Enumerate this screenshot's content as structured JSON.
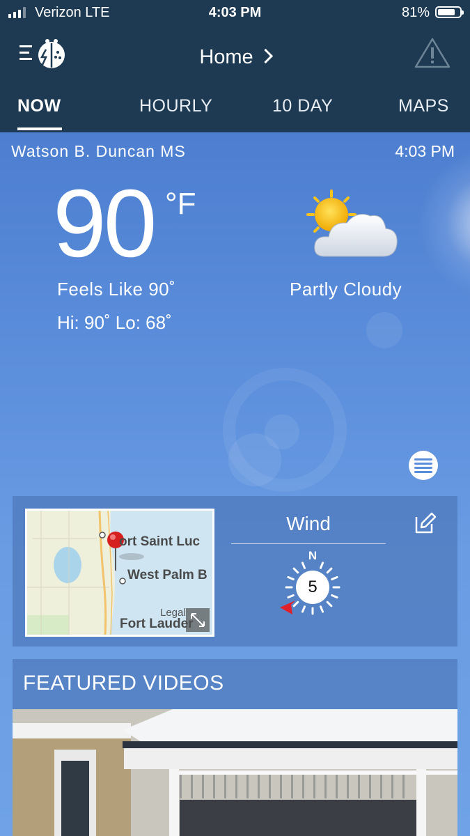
{
  "status_bar": {
    "carrier": "Verizon  LTE",
    "time": "4:03 PM",
    "battery": "81%",
    "battery_level": 0.81
  },
  "header": {
    "title": "Home",
    "menu_icon": "menu-logo-icon",
    "alert_icon": "warning-triangle-icon"
  },
  "tabs": [
    {
      "label": "NOW",
      "active": true
    },
    {
      "label": "HOURLY",
      "active": false
    },
    {
      "label": "10  DAY",
      "active": false
    },
    {
      "label": "MAPS",
      "active": false
    }
  ],
  "current": {
    "location": "Watson  B.  Duncan  MS",
    "time": "4:03  PM",
    "temperature": "90",
    "unit": "°F",
    "feels_like": "Feels  Like  90˚",
    "hi_lo": "Hi: 90˚  Lo: 68˚",
    "condition": "Partly  Cloudy",
    "condition_icon": "partly-cloudy-icon"
  },
  "map": {
    "labels": [
      "ort Saint Luc",
      "West Palm B",
      "Fort Lauder"
    ],
    "legal": "Legal"
  },
  "wind": {
    "title": "Wind",
    "direction": "N",
    "speed": "5"
  },
  "featured": {
    "title": "FEATURED  VIDEOS"
  },
  "colors": {
    "header_bg": "#1d3a52",
    "sky": "#5a8ddb",
    "card": "#4a6fa8"
  }
}
